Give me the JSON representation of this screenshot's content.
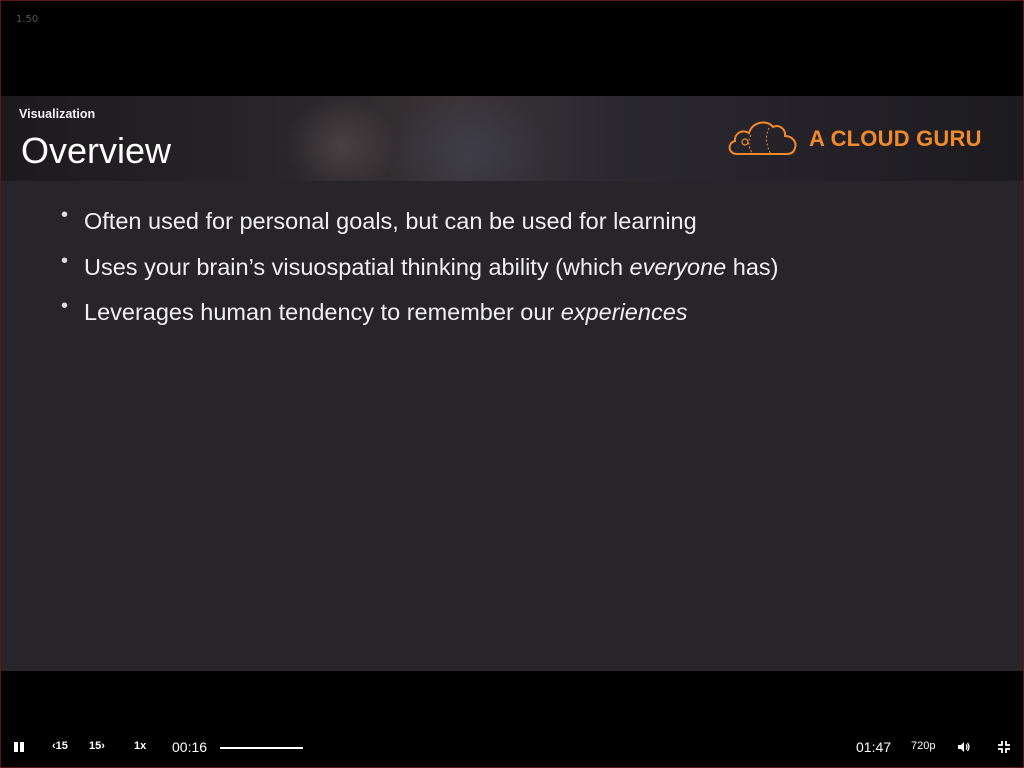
{
  "player": {
    "version_label": "1.50",
    "current_time": "00:16",
    "duration": "01:47",
    "skip_back_label": "15",
    "skip_forward_label": "15",
    "speed_label": "1x",
    "quality_label": "720p",
    "progress_fraction": 0.15,
    "icons": [
      "pause-icon",
      "skip-back-icon",
      "skip-forward-icon",
      "volume-icon",
      "exit-fullscreen-icon"
    ]
  },
  "slide": {
    "section_label": "Visualization",
    "title": "Overview",
    "logo_text": "A CLOUD GURU",
    "bullets": [
      {
        "before": "Often used for personal goals, but can be used for learning",
        "em": "",
        "after": ""
      },
      {
        "before": "Uses your brain’s visuospatial thinking ability (which ",
        "em": "everyone",
        "after": " has)"
      },
      {
        "before": "Leverages human tendency to remember our ",
        "em": "experiences",
        "after": ""
      }
    ]
  },
  "colors": {
    "brand_orange": "#f28a2a",
    "slide_bg": "#27252a",
    "player_bg": "#000000"
  }
}
